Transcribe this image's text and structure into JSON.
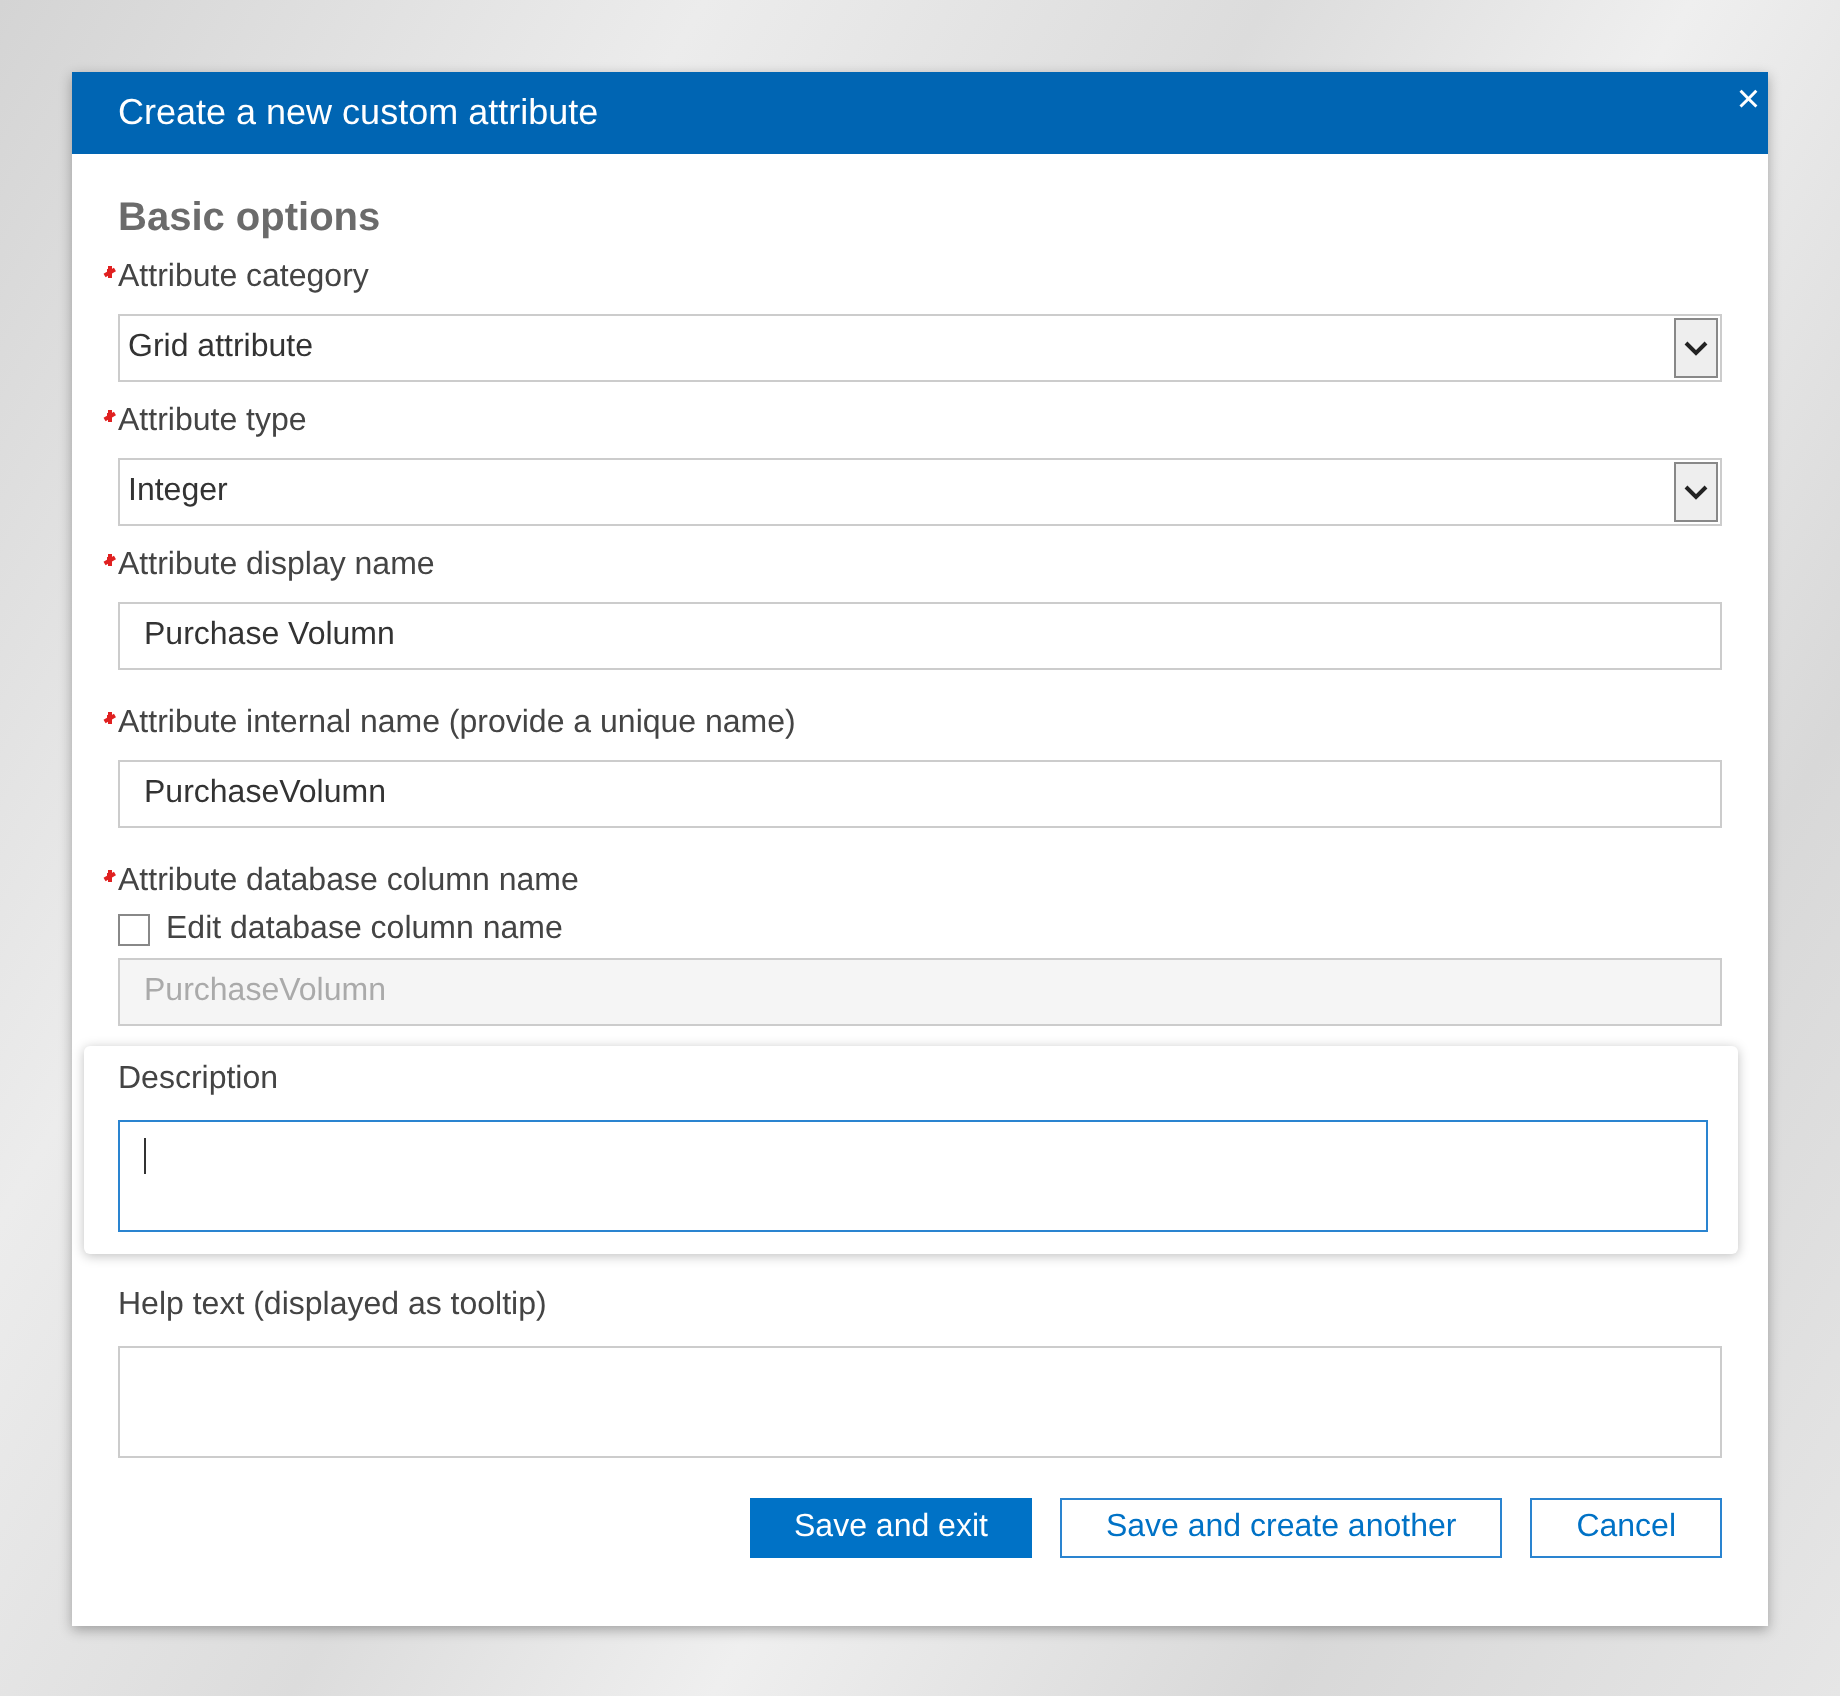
{
  "dialog": {
    "title": "Create a new custom attribute",
    "close": "×"
  },
  "section_title": "Basic options",
  "fields": [
    {
      "kind": "select",
      "label": "Attribute category",
      "required": true,
      "value": "Grid attribute"
    },
    {
      "kind": "select",
      "label": "Attribute type",
      "required": true,
      "value": "Integer"
    },
    {
      "kind": "text",
      "label": "Attribute display name",
      "required": true,
      "value": "Purchase Volumn"
    },
    {
      "kind": "text",
      "label": "Attribute internal name (provide a unique name)",
      "required": true,
      "value": "PurchaseVolumn"
    },
    {
      "kind": "locked",
      "label": "Attribute database column name",
      "required": true,
      "checkbox": {
        "label": "Edit database column name",
        "checked": false
      },
      "value": "PurchaseVolumn"
    },
    {
      "kind": "textarea",
      "label": "Description",
      "required": false,
      "focused": true
    },
    {
      "kind": "textarea",
      "label": "Help text (displayed as tooltip)",
      "required": false,
      "focused": false
    }
  ],
  "buttons": [
    {
      "label": "Save and exit",
      "kind": "primary"
    },
    {
      "label": "Save and create another",
      "kind": "secondary"
    },
    {
      "label": "Cancel",
      "kind": "secondary"
    }
  ]
}
